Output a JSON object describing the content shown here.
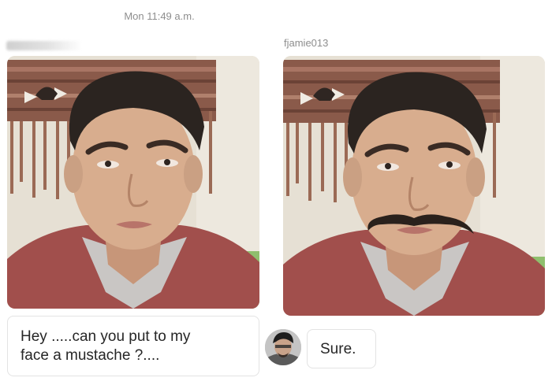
{
  "conversation": {
    "timestamp": "Mon 11:49 a.m.",
    "sender_right_username": "fjamie013",
    "message_left_line1": "Hey .....can you put to my",
    "message_left_line2": "face a mustache ?....",
    "message_right": "Sure."
  },
  "photos": {
    "left": {
      "content": "selfie",
      "edit": "none"
    },
    "right": {
      "content": "selfie",
      "edit": "mustache"
    }
  },
  "colors": {
    "meta_text": "#8e8e8e",
    "message_text": "#262626",
    "bubble_border": "#e3e3e3",
    "wall": "#e6e0d4",
    "tapestry": "#8a5a4a",
    "shirt": "#a14f4c",
    "skin": "#d8ad8e",
    "hair": "#2b2420",
    "mustache": "#2a211c"
  }
}
